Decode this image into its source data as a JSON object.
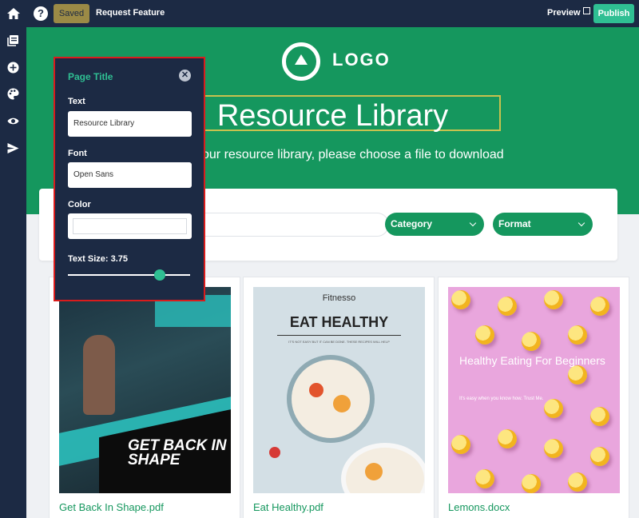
{
  "topbar": {
    "saved_label": "Saved",
    "request_label": "Request Feature",
    "preview_label": "Preview",
    "publish_label": "Publish",
    "help_glyph": "?"
  },
  "sidebar": {
    "icons": [
      "library-icon",
      "add-icon",
      "palette-icon",
      "eye-icon",
      "send-icon"
    ]
  },
  "hero": {
    "logo_text": "LOGO",
    "title": "Resource Library",
    "subtitle": "our resource library, please choose a file to download"
  },
  "filters": {
    "category_label": "Category",
    "format_label": "Format"
  },
  "cards": [
    {
      "name": "Get Back In Shape.pdf",
      "thumb_text": "GET BACK IN SHAPE"
    },
    {
      "name": "Eat Healthy.pdf",
      "thumb_brand": "Fitnesso",
      "thumb_heading": "EAT HEALTHY",
      "thumb_tag": "IT'S NOT EASY BUT IT CAN BE DONE. THESE RECIPES WILL HELP"
    },
    {
      "name": "Lemons.docx",
      "thumb_text": "Healthy Eating For Beginners",
      "thumb_small": "It's easy when you know how. Trust Me."
    }
  ],
  "panel": {
    "title": "Page Title",
    "close_glyph": "✕",
    "text_label": "Text",
    "text_value": "Resource Library",
    "font_label": "Font",
    "font_value": "Open Sans",
    "color_label": "Color",
    "size_label": "Text Size: 3.75",
    "size_fraction": 0.75
  },
  "colors": {
    "navy": "#1c2a44",
    "green": "#15975e",
    "accent": "#2fbf93",
    "highlight": "#d91c1c"
  }
}
